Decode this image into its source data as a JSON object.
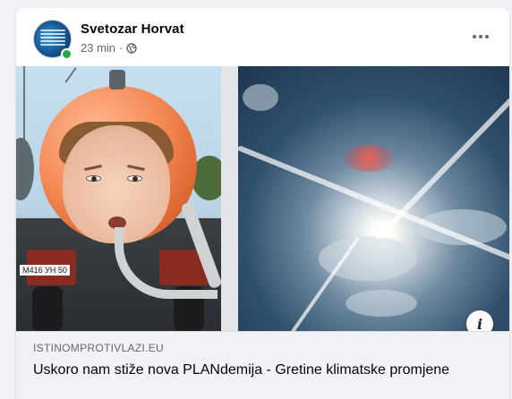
{
  "post": {
    "author": "Svetozar Horvat",
    "time": "23 min",
    "separator": "·",
    "privacy_icon": "globe-icon",
    "more_icon": "more-dots-icon"
  },
  "media": {
    "left_image": "vacuum-truck-tank-with-face",
    "right_image": "sun-and-contrails-sky",
    "plate_text": "M416 УН 50",
    "info_icon": "i"
  },
  "link": {
    "domain": "ISTINOMPROTIVLAZI.EU",
    "title": "Uskoro nam stiže nova PLANdemija - Gretine klimatske promjene"
  },
  "colors": {
    "accent_text": "#050505",
    "secondary_text": "#65676b",
    "online": "#31a24c",
    "link_bg": "#f0f2f5"
  }
}
